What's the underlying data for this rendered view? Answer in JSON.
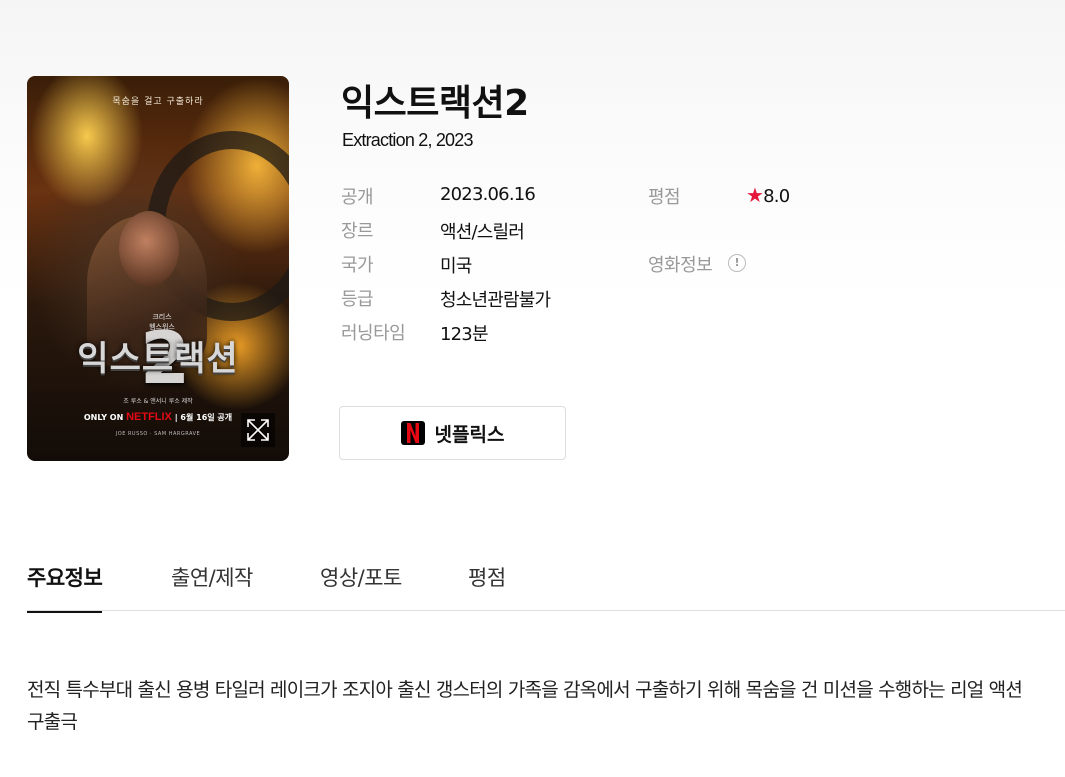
{
  "movie": {
    "title": "익스트랙션2",
    "subtitle": "Extraction 2, 2023",
    "poster": {
      "tagline": "목숨을 걸고 구출하라",
      "cast_line1": "크리스",
      "cast_line2": "헴스워스",
      "title_text": "익스트랙션",
      "numeral": "2",
      "credit": "조 루소 & 앤서니 루소 제작",
      "only_on": "ONLY ON",
      "network": "NETFLIX",
      "release": "6월 16일 공개",
      "names": "JOE RUSSO · SAM HARGRAVE"
    }
  },
  "info": {
    "release_label": "공개",
    "release_value": "2023.06.16",
    "genre_label": "장르",
    "genre_value": "액션/스릴러",
    "country_label": "국가",
    "country_value": "미국",
    "rating_label": "등급",
    "rating_value": "청소년관람불가",
    "runtime_label": "러닝타임",
    "runtime_value": "123분",
    "score_label": "평점",
    "score_star": "★",
    "score_value": "8.0",
    "movie_info_label": "영화정보",
    "movie_info_icon": "!"
  },
  "watch_button": {
    "label": "넷플릭스",
    "logo_letter": "N",
    "logo_color": "#e50914"
  },
  "tabs": [
    {
      "label": "주요정보",
      "active": true
    },
    {
      "label": "출연/제작",
      "active": false
    },
    {
      "label": "영상/포토",
      "active": false
    },
    {
      "label": "평점",
      "active": false
    }
  ],
  "synopsis": "전직 특수부대 출신 용병 타일러 레이크가 조지아 출신 갱스터의 가족을 감옥에서 구출하기 위해 목숨을 건 미션을 수행하는 리얼 액션 구출극",
  "colors": {
    "accent_star": "#e5183b",
    "netflix_red": "#e50914"
  }
}
